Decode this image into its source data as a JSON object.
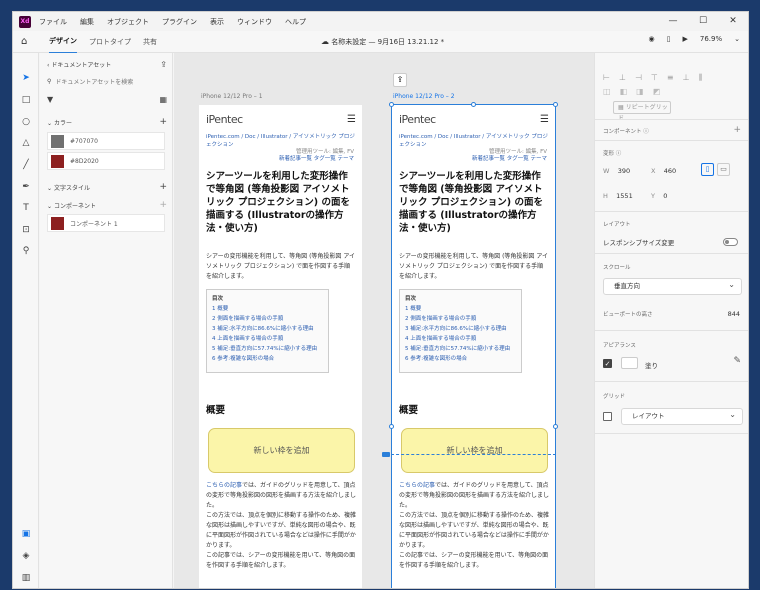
{
  "app": {
    "logo": "Xd"
  },
  "menu": [
    "ファイル",
    "編集",
    "オブジェクト",
    "プラグイン",
    "表示",
    "ウィンドウ",
    "ヘルプ"
  ],
  "window_controls": {
    "minimize": "—",
    "maximize": "☐",
    "close": "✕"
  },
  "toolbar": {
    "tabs": [
      "デザイン",
      "プロトタイプ",
      "共有"
    ],
    "doc_title": "名称未設定 — 9月16日 13.21.12 *",
    "zoom": "76.9%"
  },
  "left_panel": {
    "section_title": "ドキュメントアセット",
    "search_placeholder": "ドキュメントアセットを検索",
    "colors_heading": "カラー",
    "colors": [
      {
        "label": "#707070",
        "hex": "#707070"
      },
      {
        "label": "#8D2020",
        "hex": "#8D2020"
      }
    ],
    "text_styles_heading": "文字スタイル",
    "components_heading": "コンポーネント",
    "components": [
      {
        "label": "コンポーネント 1",
        "hex": "#8D2020"
      }
    ]
  },
  "artboards": [
    {
      "label": "iPhone 12/12 Pro – 1",
      "selected": false
    },
    {
      "label": "iPhone 12/12 Pro – 2",
      "selected": true
    }
  ],
  "page": {
    "brand": "iPentec",
    "breadcrumb": "iPentec.com / Doc / Illustrator / アイソメトリック プロジェクション",
    "tags_line1": "管理用ツール: 編集, FV",
    "tags_line2": "新着記事一覧   タグ一覧   テーマ",
    "title": "シアーツールを利用した変形操作で等角図 (等角投影図 アイソメトリック プロジェクション) の面を描画する (Illustratorの操作方法・使い方)",
    "lead": "シアーの変形機能を利用して、等角図 (等角投影図 アイソメトリック プロジェクション) で面を作図する手順を紹介します。",
    "toc_title": "目次",
    "toc_items": [
      "1 概要",
      "2 側面を描画する場合の手順",
      "3 補足:水平方向に86.6%に縮小する理由",
      "4 上面を描画する場合の手順",
      "5 補足:垂直方向に57.74%に縮小する理由",
      "6 参考:複雑な図形の場合"
    ],
    "section_heading": "概要",
    "add_frame": "新しい枠を追加",
    "body_link": "こちらの記事",
    "body_1": "では、ガイドのグリッドを用意して、頂点の変形で等角投影図の図形を描画する方法を紹介しました。",
    "body_2": "この方法では、頂点を個別に移動する操作のため、複雑な図形は描画しやすいですが、単純な図形の場合や、既に平面図形が作図されている場合などは操作に手間がかかります。",
    "body_3": "この記事では、シアーの変形機能を用いて、等角図の面を作図する手順を紹介します。"
  },
  "right_panel": {
    "repeat_grid": "リピートグリッド",
    "component_heading": "コンポーネント",
    "transform_heading": "変形",
    "W": "390",
    "X": "460",
    "H": "1551",
    "Y": "0",
    "layout_heading": "レイアウト",
    "responsive_label": "レスポンシブサイズ変更",
    "scroll_heading": "スクロール",
    "scroll_value": "垂直方向",
    "viewport_label": "ビューポートの高さ",
    "viewport_value": "844",
    "appearance_heading": "アピアランス",
    "fill_label": "塗り",
    "grid_heading": "グリッド",
    "grid_value": "レイアウト"
  }
}
